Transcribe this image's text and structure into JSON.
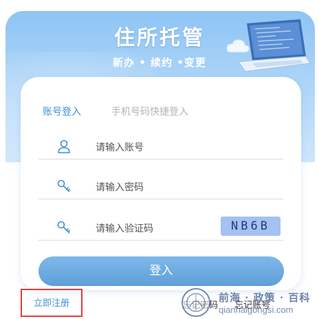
{
  "header": {
    "title": "住所托管",
    "subtitle": "新办 • 续约 •变更"
  },
  "tabs": [
    {
      "label": "账号登入",
      "active": true
    },
    {
      "label": "手机号码快捷登入",
      "active": false
    }
  ],
  "form": {
    "account": {
      "placeholder": "请输入账号",
      "icon": "user-icon"
    },
    "password": {
      "placeholder": "请输入密码",
      "icon": "key-icon"
    },
    "captcha": {
      "placeholder": "请输入验证码",
      "icon": "key-icon",
      "code": "NB6B"
    }
  },
  "login_button": "登入",
  "register_link": "立即注册",
  "links": {
    "forgot_password": "忘记密码",
    "forgot_account": "忘记账号"
  },
  "watermark": {
    "line1": "前海 · 政策 · 百科",
    "line2": "qianhaigongsi.com"
  },
  "colors": {
    "accent": "#3f8fd4",
    "button": "#6aa9de",
    "banner": "#8ec4f4",
    "captcha_bg": "#a3c1f2",
    "highlight_border": "#e23b3b"
  }
}
